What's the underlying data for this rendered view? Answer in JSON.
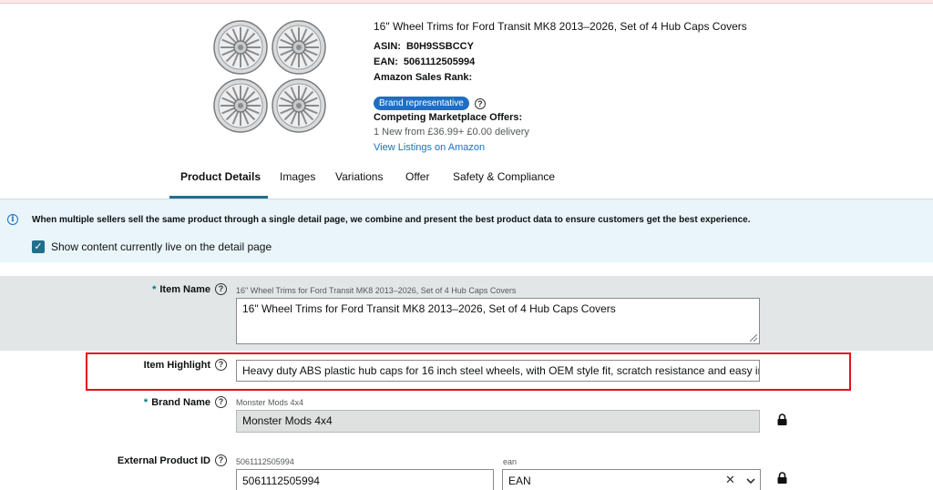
{
  "product": {
    "title": "16\" Wheel Trims for Ford Transit MK8 2013–2026, Set of 4 Hub Caps Covers",
    "asin_label": "ASIN:",
    "asin": "B0H9SSBCCY",
    "ean_label": "EAN:",
    "ean": "5061112505994",
    "sales_rank_label": "Amazon Sales Rank:",
    "badge": "Brand representative",
    "competing_label": "Competing Marketplace Offers:",
    "offer_text": "1 New  from £36.99+ £0.00 delivery",
    "view_listings": "View Listings on Amazon"
  },
  "tabs": [
    {
      "label": "Product Details",
      "active": true
    },
    {
      "label": "Images"
    },
    {
      "label": "Variations"
    },
    {
      "label": "Offer"
    },
    {
      "label": "Safety & Compliance"
    }
  ],
  "banner": {
    "text": "When multiple sellers sell the same product through a single detail page, we combine and present the best product data to ensure customers get the best experience.",
    "checkbox_label": "Show content currently live on the detail page",
    "checkbox_checked": true
  },
  "form": {
    "item_name": {
      "label": "Item Name",
      "required": true,
      "live_value": "16\" Wheel Trims for Ford Transit MK8 2013–2026, Set of 4 Hub Caps Covers",
      "value": "16\" Wheel Trims for Ford Transit MK8 2013–2026, Set of 4 Hub Caps Covers"
    },
    "item_highlight": {
      "label": "Item Highlight",
      "value": "Heavy duty ABS plastic hub caps for 16 inch steel wheels, with OEM style fit, scratch resistance and easy insta"
    },
    "brand_name": {
      "label": "Brand Name",
      "required": true,
      "live_value": "Monster Mods 4x4",
      "value": "Monster Mods 4x4"
    },
    "external_id": {
      "label": "External Product ID",
      "live_value": "5061112505994",
      "value": "5061112505994",
      "type_live_value": "ean",
      "type_value": "EAN"
    }
  },
  "colors": {
    "accent": "#1f6f8b",
    "link": "#1f6ec3",
    "highlight_border": "#e3121b",
    "banner_bg": "#e9f5fb"
  }
}
